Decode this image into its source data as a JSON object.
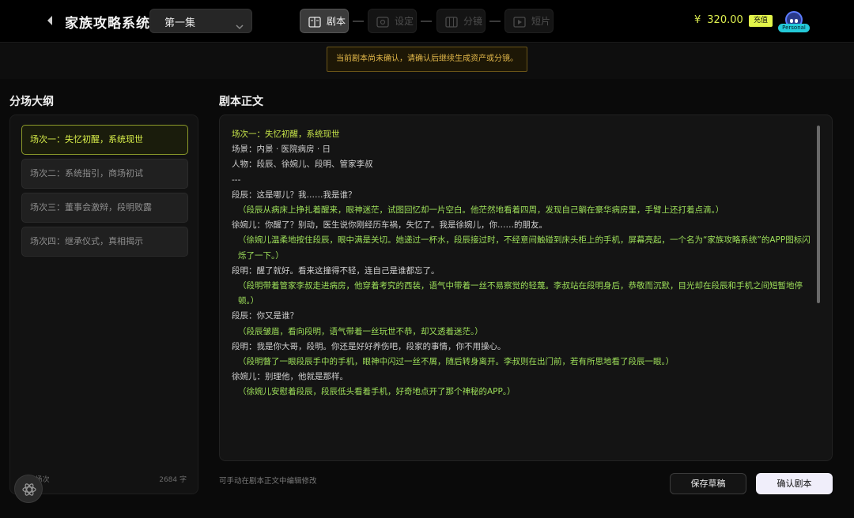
{
  "header": {
    "title": "家族攻略系统",
    "episode": "第一集",
    "steps": [
      {
        "label": "剧本",
        "icon": "book-icon",
        "active": true
      },
      {
        "label": "设定",
        "icon": "settings-icon",
        "active": false
      },
      {
        "label": "分镜",
        "icon": "storyboard-icon",
        "active": false
      },
      {
        "label": "短片",
        "icon": "video-icon",
        "active": false
      }
    ],
    "currency": "¥",
    "balance": "320.00",
    "recharge_label": "充值",
    "avatar_tag": "Personal"
  },
  "notice": "当前剧本尚未确认，请确认后继续生成资产或分镜。",
  "outline": {
    "title": "分场大纲",
    "scenes": [
      {
        "label": "场次一：失忆初醒，系统现世",
        "active": true
      },
      {
        "label": "场次二：系统指引，商场初试",
        "active": false
      },
      {
        "label": "场次三：董事会激辩，段明败露",
        "active": false
      },
      {
        "label": "场次四：继承仪式，真相揭示",
        "active": false
      }
    ],
    "count": "4 个场次",
    "chars": "2684 字"
  },
  "script": {
    "title": "剧本正文",
    "lines": [
      {
        "text": "场次一：失忆初醒，系统现世",
        "style": "hl"
      },
      {
        "text": "场景：内景 · 医院病房 · 日",
        "style": "normal"
      },
      {
        "text": "人物：段辰、徐婉儿、段明、管家李叔",
        "style": "normal"
      },
      {
        "text": "---",
        "style": "normal"
      },
      {
        "text": "段辰：这是哪儿？我……我是谁？",
        "style": "normal"
      },
      {
        "text": "（段辰从病床上挣扎着醒来，眼神迷茫，试图回忆却一片空白。他茫然地看着四周，发现自己躺在豪华病房里，手臂上还打着点滴。）",
        "style": "act"
      },
      {
        "text": "徐婉儿：你醒了？别动，医生说你刚经历车祸，失忆了。我是徐婉儿，你……的朋友。",
        "style": "normal"
      },
      {
        "text": "（徐婉儿温柔地按住段辰，眼中满是关切。她递过一杯水，段辰接过时，不经意间触碰到床头柜上的手机，屏幕亮起，一个名为“家族攻略系统”的APP图标闪烁了一下。）",
        "style": "act"
      },
      {
        "text": "段明：醒了就好。看来这撞得不轻，连自己是谁都忘了。",
        "style": "normal"
      },
      {
        "text": "（段明带着管家李叔走进病房，他穿着考究的西装，语气中带着一丝不易察觉的轻蔑。李叔站在段明身后，恭敬而沉默，目光却在段辰和手机之间短暂地停顿。）",
        "style": "act"
      },
      {
        "text": "段辰：你又是谁？",
        "style": "normal"
      },
      {
        "text": "（段辰皱眉，看向段明，语气带着一丝玩世不恭，却又透着迷茫。）",
        "style": "act"
      },
      {
        "text": "段明：我是你大哥，段明。你还是好好养伤吧，段家的事情，你不用操心。",
        "style": "normal"
      },
      {
        "text": "（段明瞥了一眼段辰手中的手机，眼神中闪过一丝不屑，随后转身离开。李叔则在出门前，若有所思地看了段辰一眼。）",
        "style": "act"
      },
      {
        "text": "徐婉儿：别理他，他就是那样。",
        "style": "normal"
      },
      {
        "text": "（徐婉儿安慰着段辰，段辰低头看着手机，好奇地点开了那个神秘的APP。）",
        "style": "act"
      }
    ],
    "hint": "可手动在剧本正文中编辑修改"
  },
  "actions": {
    "save": "保存草稿",
    "confirm": "确认剧本"
  },
  "colors": {
    "accent": "#d9ef4a",
    "notice_text": "#e3b84a",
    "action_text": "#9ee05a"
  }
}
